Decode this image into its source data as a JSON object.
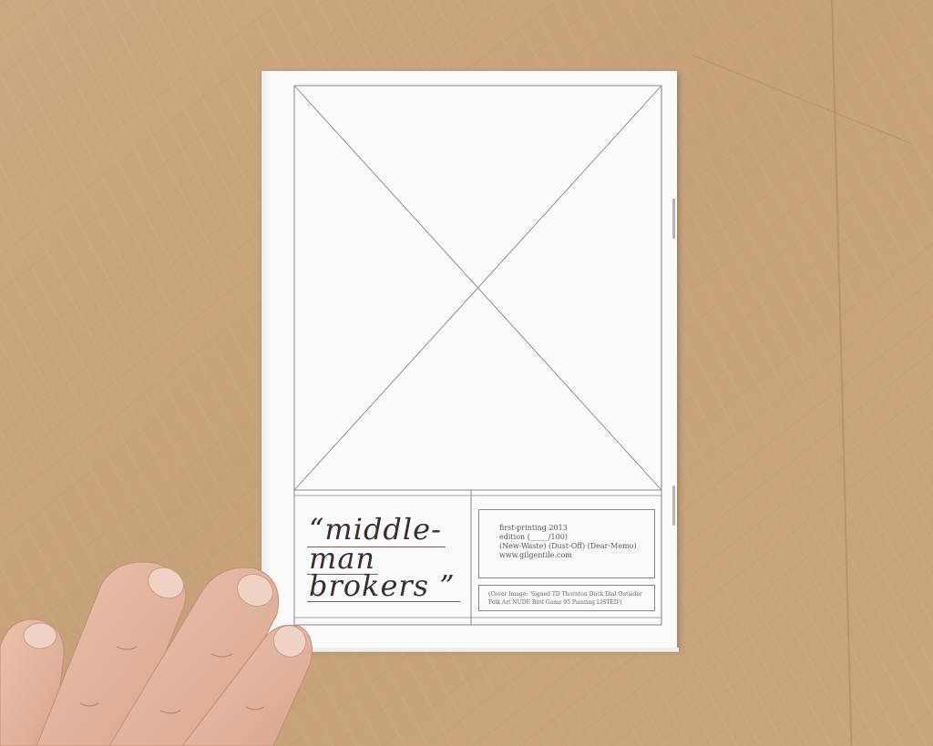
{
  "scene": {
    "description_colors": {
      "background": "#c9a57e",
      "paper": "#fbfbfb",
      "ink": "#3a2f2b",
      "skin": "#e2b39c"
    }
  },
  "booklet": {
    "title_lines": [
      "“middle-",
      "man",
      "brokers ”"
    ],
    "info": [
      "first-printing 2013",
      "edition (_____/100)",
      "(New-Waste) (Dust-Off) (Dear-Memo)",
      "www.gilgentile.com"
    ],
    "credit": [
      "(Cover Image: 'Signed TD Thornton Duck Dial Outsider",
      "Folk Art NUDE Bird Game 95 Painting LISTED')"
    ]
  }
}
